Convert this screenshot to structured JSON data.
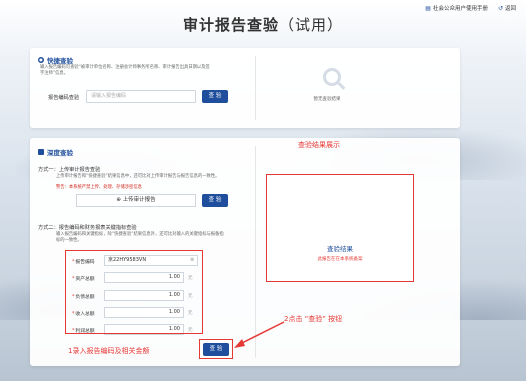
{
  "topnav": {
    "manual": "社会公众用户使用手册",
    "back": "返回"
  },
  "page": {
    "title": "审计报告查验",
    "subtitle": "（试用）"
  },
  "quick_check": {
    "title": "快捷查验",
    "desc_line1": "输入报告编码可查验“被审计单位名称、注册会计师事务所名称、审计报告出具日期以及签",
    "desc_line2": "字注师”信息。",
    "field_label": "报告编码查验",
    "placeholder": "请输入报告编码",
    "button": "查 验",
    "empty_text": "暂无查验结果"
  },
  "deep_check": {
    "title": "深度查验",
    "method1_title": "方式一：上传审计报告查验",
    "method1_desc": "上传审计报告和“快捷查验”结果信息中，还可比对上传审计报告与报告信息的一致性。",
    "warning": "警告：本系统严禁上传、处理、存储涉密信息",
    "upload_button": "上传审计报告",
    "check_button": "查 验",
    "method2_title": "方式二：报告编码和财务报表关键指标查验",
    "method2_desc_line1": "输入报告编码和关键指标，除“快捷查验”结果信息外，还可比对输入的关键指标与报备指",
    "method2_desc_line2": "标的一致性。",
    "fields": [
      {
        "label": "报告编码",
        "value": "京22HY9583VN",
        "unit": ""
      },
      {
        "label": "资产总额",
        "value": "1.00",
        "unit": "元"
      },
      {
        "label": "负债总额",
        "value": "1.00",
        "unit": "元"
      },
      {
        "label": "收入总额",
        "value": "1.00",
        "unit": "元"
      },
      {
        "label": "利润总额",
        "value": "1.00",
        "unit": "元"
      }
    ],
    "submit_button": "查 验"
  },
  "result": {
    "heading": "查验结果",
    "message": "此报告在在本系统备案"
  },
  "annotations": {
    "result_display": "查验结果展示",
    "step1": "1录入报告编码及相关金额",
    "step2": "2点击 “查验” 按钮"
  },
  "colors": {
    "primary": "#1f4e9c",
    "annotation_red": "#e53935"
  }
}
